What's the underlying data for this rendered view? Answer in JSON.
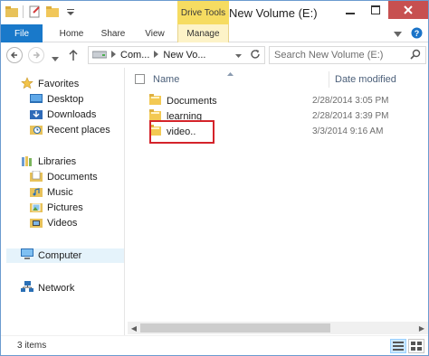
{
  "window": {
    "title": "New Volume (E:)",
    "context_tab": "Drive Tools"
  },
  "ribbon": {
    "tabs": [
      {
        "label": "File"
      },
      {
        "label": "Home"
      },
      {
        "label": "Share"
      },
      {
        "label": "View"
      },
      {
        "label": "Manage"
      }
    ]
  },
  "address": {
    "crumbs": [
      "Com...",
      "New Vo..."
    ],
    "search_placeholder": "Search New Volume (E:)"
  },
  "nav": {
    "favorites": {
      "label": "Favorites",
      "items": [
        "Desktop",
        "Downloads",
        "Recent places"
      ]
    },
    "libraries": {
      "label": "Libraries",
      "items": [
        "Documents",
        "Music",
        "Pictures",
        "Videos"
      ]
    },
    "computer": "Computer",
    "network": "Network"
  },
  "columns": {
    "name": "Name",
    "date": "Date modified"
  },
  "files": [
    {
      "name": "Documents",
      "date": "2/28/2014 3:05 PM"
    },
    {
      "name": "learning",
      "date": "2/28/2014 3:39 PM"
    },
    {
      "name": "video..",
      "date": "3/3/2014 9:16 AM"
    }
  ],
  "status": {
    "item_count": "3 items"
  },
  "colors": {
    "accent": "#1979ca",
    "drive_tools": "#f6dc61",
    "highlight": "#d4232a",
    "close": "#c75050"
  }
}
